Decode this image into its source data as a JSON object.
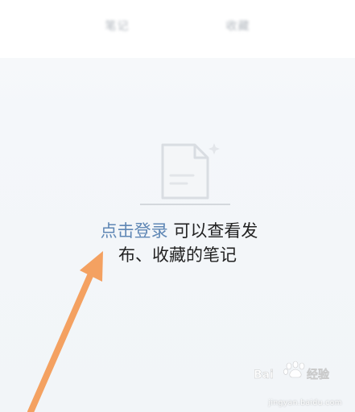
{
  "tabs": {
    "items": [
      {
        "label": "笔记"
      },
      {
        "label": "收藏"
      }
    ]
  },
  "empty_state": {
    "icon": "document-icon",
    "login_link": "点击登录",
    "message_part1": "可以查看发",
    "message_part2": "布、收藏的笔记"
  },
  "annotation": {
    "arrow_color": "#f4a161"
  },
  "watermark": {
    "logo_text": "Baidu 经验",
    "url": "jingyan.baidu.com"
  },
  "colors": {
    "link": "#5f87b5",
    "text": "#222222",
    "background": "#f3f6f9"
  }
}
